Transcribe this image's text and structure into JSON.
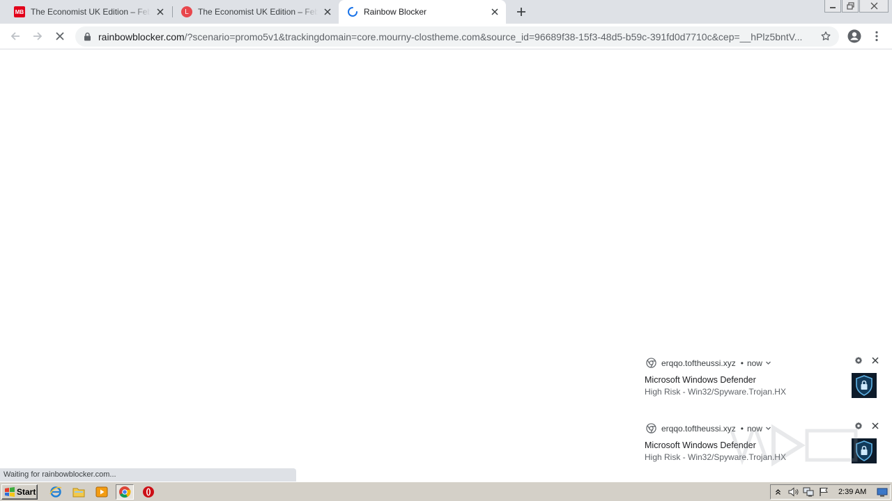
{
  "browser": {
    "tabs": [
      {
        "title": "The Economist UK Edition – February",
        "favicon": "mb-logo-icon",
        "favicon_text": "MB",
        "favicon_color": "#e2001a",
        "active": false
      },
      {
        "title": "The Economist UK Edition – February",
        "favicon": "l-logo-icon",
        "favicon_text": "L",
        "favicon_color": "#e8474d",
        "active": false
      },
      {
        "title": "Rainbow Blocker",
        "favicon": "loading-spinner-icon",
        "active": true
      }
    ],
    "url": {
      "host": "rainbowblocker.com",
      "rest": "/?scenario=promo5v1&trackingdomain=core.mourny-clostheme.com&source_id=96689f38-15f3-48d5-b59c-391fd0d7710c&cep=__hPlz5bntV..."
    }
  },
  "status_bar": {
    "text": "Waiting for rainbowblocker.com..."
  },
  "notifications": [
    {
      "origin": "erqqo.toftheussi.xyz",
      "time": "now",
      "title": "Microsoft Windows Defender",
      "body": "High Risk - Win32/Spyware.Trojan.HX",
      "image_icon": "shield-lock-icon"
    },
    {
      "origin": "erqqo.toftheussi.xyz",
      "time": "now",
      "title": "Microsoft Windows Defender",
      "body": "High Risk - Win32/Spyware.Trojan.HX",
      "image_icon": "shield-lock-icon"
    }
  ],
  "taskbar": {
    "start_label": "Start",
    "apps": [
      "ie-icon",
      "explorer-folder-icon",
      "media-player-icon",
      "chrome-icon",
      "opera-icon"
    ],
    "clock": "2:39 AM"
  },
  "colors": {
    "tabstrip_bg": "#dee1e6",
    "omnibox_bg": "#f1f3f4",
    "spinner_blue": "#1a73e8",
    "taskbar_bg": "#d4d0c8",
    "opera_red": "#cc0f16"
  }
}
